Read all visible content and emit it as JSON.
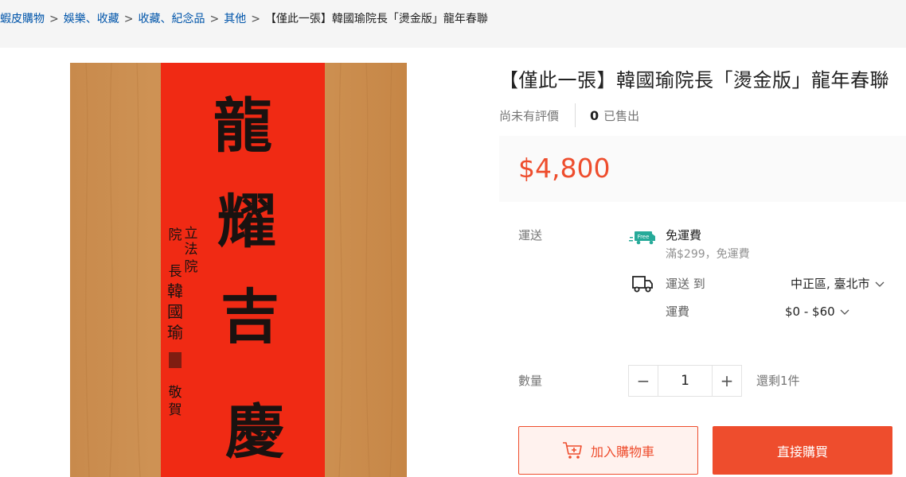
{
  "breadcrumb": {
    "items": [
      "蝦皮購物",
      "娛樂、收藏",
      "收藏、紀念品",
      "其他"
    ],
    "separator": ">",
    "current": "【僅此一張】韓國瑜院長「燙金版」龍年春聯"
  },
  "product": {
    "title": "【僅此一張】韓國瑜院長「燙金版」龍年春聯",
    "rating_text": "尚未有評價",
    "sold_count": "0",
    "sold_label": "已售出",
    "price": "$4,800",
    "image": {
      "main_chars": [
        "龍",
        "耀",
        "吉",
        "慶"
      ],
      "side_text": [
        "立",
        "法",
        "院",
        "院",
        "長",
        "韓",
        "國",
        "瑜",
        "敬",
        "賀"
      ]
    }
  },
  "shipping": {
    "label": "運送",
    "free_badge": "Free",
    "free_title": "免運費",
    "free_desc": "滿$299，免運費",
    "ship_to_label": "運送 到",
    "ship_to_value": "中正區, 臺北市",
    "fee_label": "運費",
    "fee_value": "$0 - $60"
  },
  "quantity": {
    "label": "數量",
    "minus": "−",
    "value": "1",
    "plus": "+",
    "stock_text": "還剩1件"
  },
  "actions": {
    "add_to_cart": "加入購物車",
    "buy_now": "直接購買"
  },
  "colors": {
    "accent": "#ee4d2d",
    "free_green": "#26aa99",
    "couplet_red": "#f02a14"
  }
}
